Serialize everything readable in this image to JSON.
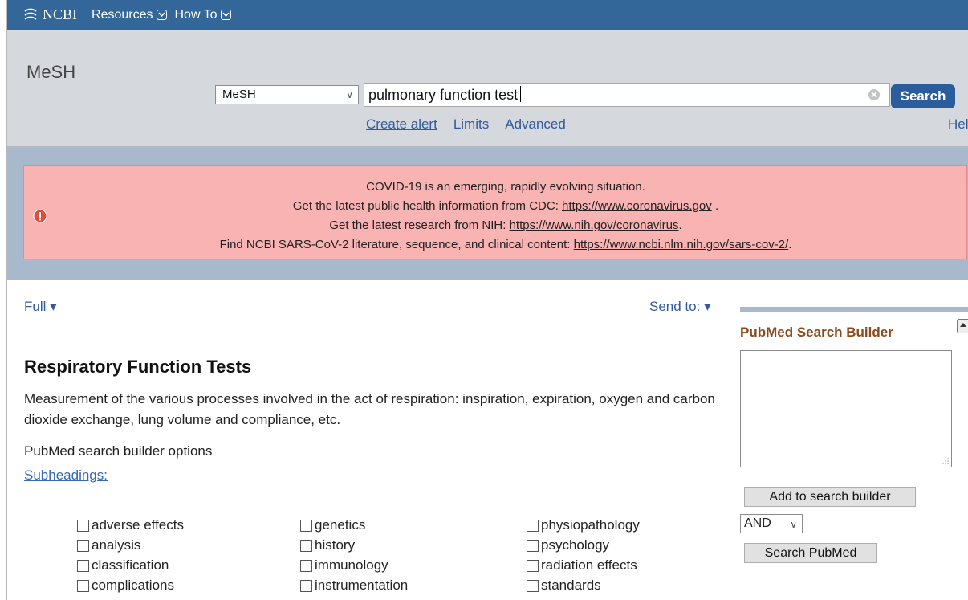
{
  "topbar": {
    "logo_text": "NCBI",
    "menu": [
      {
        "label": "Resources"
      },
      {
        "label": "How To"
      }
    ]
  },
  "search": {
    "db_title": "MeSH",
    "db_select_value": "MeSH",
    "query": "pulmonary function test",
    "button_label": "Search",
    "links": {
      "create_alert": "Create alert",
      "limits": "Limits",
      "advanced": "Advanced",
      "help": "Help"
    }
  },
  "alert": {
    "line1": "COVID-19 is an emerging, rapidly evolving situation.",
    "line2_prefix": "Get the latest public health information from CDC: ",
    "line2_link": "https://www.coronavirus.gov",
    "line2_suffix": " .",
    "line3_prefix": "Get the latest research from NIH: ",
    "line3_link": "https://www.nih.gov/coronavirus",
    "line3_suffix": ".",
    "line4_prefix": "Find NCBI SARS-CoV-2 literature, sequence, and clinical content: ",
    "line4_link": "https://www.ncbi.nlm.nih.gov/sars-cov-2/",
    "line4_suffix": "."
  },
  "content": {
    "display_format": "Full",
    "send_to": "Send to:",
    "heading": "Respiratory Function Tests",
    "description": "Measurement of the various processes involved in the act of respiration: inspiration, expiration, oxygen and carbon dioxide exchange, lung volume and compliance, etc.",
    "builder_options_label": "PubMed search builder options",
    "subheadings_link": "Subheadings:",
    "subheadings": {
      "col1": [
        "adverse effects",
        "analysis",
        "classification",
        "complications"
      ],
      "col2": [
        "genetics",
        "history",
        "immunology",
        "instrumentation"
      ],
      "col3": [
        "physiopathology",
        "psychology",
        "radiation effects",
        "standards"
      ]
    }
  },
  "builder": {
    "title": "PubMed Search Builder",
    "add_button": "Add to search builder",
    "operator": "AND",
    "search_button": "Search PubMed"
  },
  "colors": {
    "topbar": "#336699",
    "alert_bg": "#f9b3b3",
    "link": "#335b99",
    "builder_title": "#8b4a1e"
  }
}
